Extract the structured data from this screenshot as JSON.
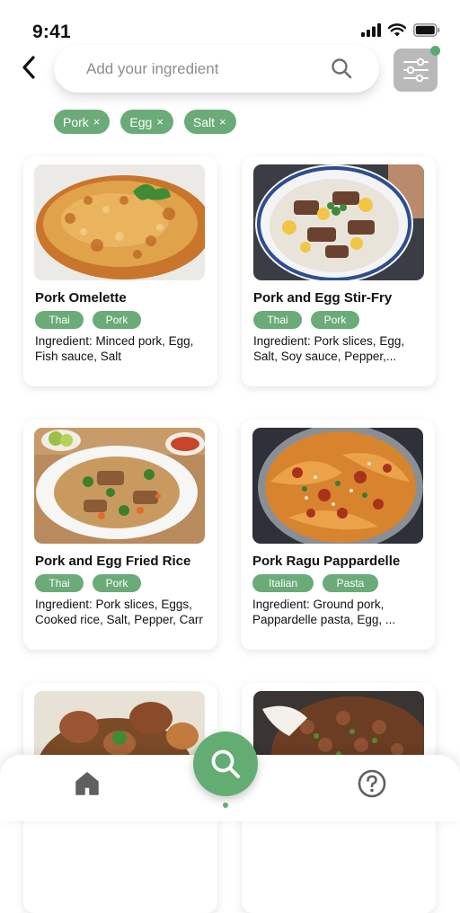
{
  "status_bar": {
    "time": "9:41"
  },
  "search": {
    "placeholder": "Add your ingredient"
  },
  "chips": [
    {
      "label": "Pork",
      "remove": "×"
    },
    {
      "label": "Egg",
      "remove": "×"
    },
    {
      "label": "Salt",
      "remove": "×"
    }
  ],
  "recipes": [
    {
      "title": "Pork Omelette",
      "tags": [
        "Thai",
        "Pork"
      ],
      "ingredients_line1": "Ingredient: Minced pork, Egg,",
      "ingredients_line2": "Fish sauce, Salt"
    },
    {
      "title": "Pork and Egg Stir-Fry",
      "tags": [
        "Thai",
        "Pork"
      ],
      "ingredients_line1": "Ingredient: Pork slices, Egg,",
      "ingredients_line2": "Salt, Soy sauce, Pepper,..."
    },
    {
      "title": "Pork and Egg Fried Rice",
      "tags": [
        "Thai",
        "Pork"
      ],
      "ingredients_line1": "Ingredient: Pork slices, Eggs,",
      "ingredients_line2": "Cooked rice, Salt, Pepper, Carr"
    },
    {
      "title": "Pork Ragu Pappardelle",
      "tags": [
        "Italian",
        "Pasta"
      ],
      "ingredients_line1": "Ingredient: Ground pork,",
      "ingredients_line2": "Pappardelle pasta, Egg, ..."
    },
    {
      "title": "",
      "tags": [],
      "ingredients_line1": "",
      "ingredients_line2": ""
    },
    {
      "title": "",
      "tags": [],
      "ingredients_line1": "",
      "ingredients_line2": ""
    }
  ],
  "icons": {
    "back": "chevron-left-icon",
    "search": "search-icon",
    "filter": "sliders-icon",
    "home": "home-icon",
    "fab": "search-icon",
    "help": "question-circle-icon"
  },
  "colors": {
    "accent": "#6aab78",
    "filter_bg": "#b9b9b9",
    "indicator": "#5aa96e"
  }
}
